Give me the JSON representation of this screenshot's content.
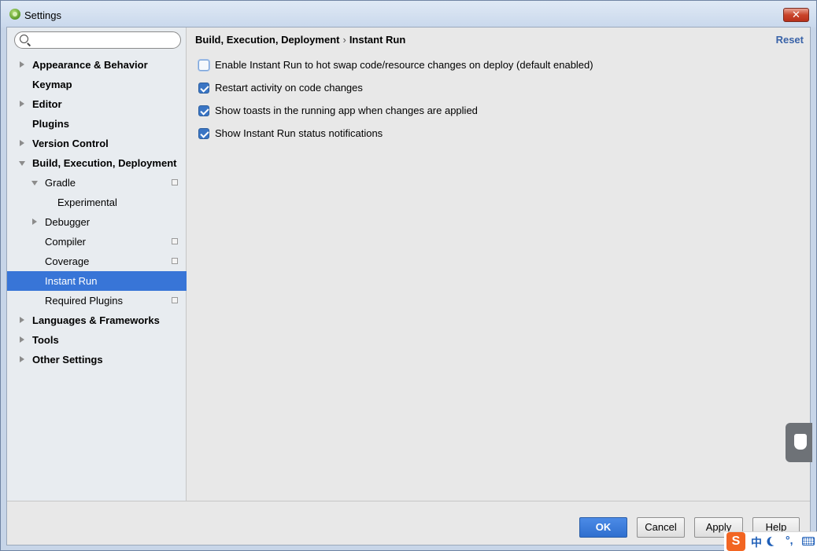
{
  "window": {
    "title": "Settings",
    "close_glyph": "✕"
  },
  "search": {
    "placeholder": "",
    "value": ""
  },
  "sidebar": {
    "items": [
      {
        "label": "Appearance & Behavior",
        "arrow": "right",
        "bold": true
      },
      {
        "label": "Keymap",
        "arrow": "none",
        "bold": true
      },
      {
        "label": "Editor",
        "arrow": "right",
        "bold": true
      },
      {
        "label": "Plugins",
        "arrow": "none",
        "bold": true
      },
      {
        "label": "Version Control",
        "arrow": "right",
        "bold": true
      },
      {
        "label": "Build, Execution, Deployment",
        "arrow": "down",
        "bold": true
      },
      {
        "label": "Gradle",
        "arrow": "down",
        "bold": false,
        "copy_icon": true
      },
      {
        "label": "Experimental",
        "arrow": "none",
        "bold": false
      },
      {
        "label": "Debugger",
        "arrow": "right",
        "bold": false
      },
      {
        "label": "Compiler",
        "arrow": "none",
        "bold": false,
        "copy_icon": true
      },
      {
        "label": "Coverage",
        "arrow": "none",
        "bold": false,
        "copy_icon": true
      },
      {
        "label": "Instant Run",
        "arrow": "none",
        "bold": false,
        "selected": true
      },
      {
        "label": "Required Plugins",
        "arrow": "none",
        "bold": false,
        "copy_icon": true
      },
      {
        "label": "Languages & Frameworks",
        "arrow": "right",
        "bold": true
      },
      {
        "label": "Tools",
        "arrow": "right",
        "bold": true
      },
      {
        "label": "Other Settings",
        "arrow": "right",
        "bold": true
      }
    ]
  },
  "content": {
    "breadcrumb": {
      "parent": "Build, Execution, Deployment",
      "separator": "›",
      "current": "Instant Run"
    },
    "reset_label": "Reset",
    "options": [
      {
        "label": "Enable Instant Run to hot swap code/resource changes on deploy (default enabled)",
        "checked": false
      },
      {
        "label": "Restart activity on code changes",
        "checked": true
      },
      {
        "label": "Show toasts in the running app when changes are applied",
        "checked": true
      },
      {
        "label": "Show Instant Run status notifications",
        "checked": true
      }
    ]
  },
  "footer": {
    "ok_label": "OK",
    "cancel_label": "Cancel",
    "apply_label": "Apply",
    "help_label": "Help"
  },
  "ime": {
    "logo": "S",
    "lang": "中",
    "punct": "°,"
  },
  "colors": {
    "selection": "#3875d7",
    "accent": "#3a75c4",
    "link": "#3a63a8"
  }
}
